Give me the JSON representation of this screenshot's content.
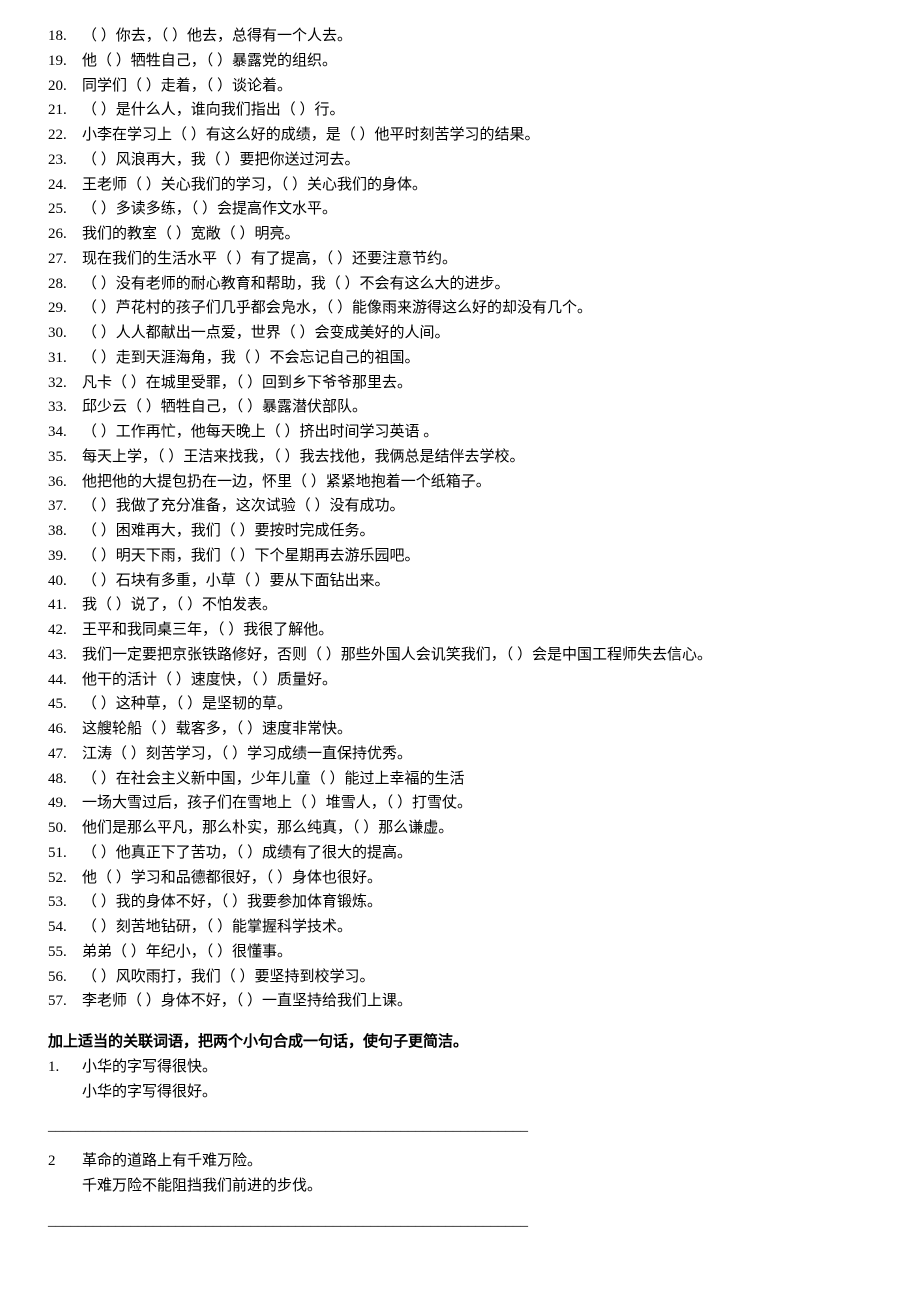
{
  "exercises": [
    {
      "n": "18.",
      "t": "（         ）你去，（         ）他去，总得有一个人去。"
    },
    {
      "n": "19.",
      "t": "他（         ）牺牲自己，（         ）暴露党的组织。"
    },
    {
      "n": "20.",
      "t": "同学们（         ）走着，（         ）谈论着。"
    },
    {
      "n": "21.",
      "t": "（         ）是什么人，谁向我们指出（         ）行。"
    },
    {
      "n": "22.",
      "t": "小李在学习上（         ）有这么好的成绩，是（         ）他平时刻苦学习的结果。"
    },
    {
      "n": "23.",
      "t": "（         ）风浪再大，我（         ）要把你送过河去。"
    },
    {
      "n": "24.",
      "t": "王老师（         ）关心我们的学习，（         ）关心我们的身体。"
    },
    {
      "n": "25.",
      "t": "（         ）多读多练，（         ）会提高作文水平。"
    },
    {
      "n": "26.",
      "t": "我们的教室（         ）宽敞（         ）明亮。"
    },
    {
      "n": "27.",
      "t": "现在我们的生活水平（         ）有了提高，（         ）还要注意节约。"
    },
    {
      "n": "28.",
      "t": "（         ）没有老师的耐心教育和帮助，我（         ）不会有这么大的进步。"
    },
    {
      "n": "29.",
      "t": "（         ）芦花村的孩子们几乎都会凫水，（         ）能像雨来游得这么好的却没有几个。"
    },
    {
      "n": "30.",
      "t": "（         ）人人都献出一点爱，世界（         ）会变成美好的人间。"
    },
    {
      "n": "31.",
      "t": "（         ）走到天涯海角，我（         ）不会忘记自己的祖国。"
    },
    {
      "n": "32.",
      "t": "凡卡（         ）在城里受罪，（         ）回到乡下爷爷那里去。"
    },
    {
      "n": "33.",
      "t": "邱少云（         ）牺牲自己，（         ）暴露潜伏部队。"
    },
    {
      "n": "34.",
      "t": "（         ）工作再忙，他每天晚上（         ）挤出时间学习英语 。"
    },
    {
      "n": "35.",
      "t": "每天上学，（         ）王洁来找我，（         ）我去找他，我俩总是结伴去学校。"
    },
    {
      "n": "36.",
      "t": "他把他的大提包扔在一边，怀里（         ）紧紧地抱着一个纸箱子。"
    },
    {
      "n": "37.",
      "t": "（         ）我做了充分准备，这次试验（         ）没有成功。"
    },
    {
      "n": "38.",
      "t": "（         ）困难再大，我们（         ）要按时完成任务。"
    },
    {
      "n": "39.",
      "t": "（         ）明天下雨，我们（         ）下个星期再去游乐园吧。"
    },
    {
      "n": "40.",
      "t": "（         ）石块有多重，小草（         ）要从下面钻出来。"
    },
    {
      "n": "41.",
      "t": "我（         ）说了，（         ）不怕发表。"
    },
    {
      "n": "42.",
      "t": "王平和我同桌三年，（         ）我很了解他。"
    },
    {
      "n": "43.",
      "t": "我们一定要把京张铁路修好，否则（       ）那些外国人会讥笑我们，（       ）会是中国工程师失去信心。"
    },
    {
      "n": "44.",
      "t": "他干的活计（         ）速度快，（         ）质量好。"
    },
    {
      "n": "45.",
      "t": "（         ）这种草，（         ）是坚韧的草。"
    },
    {
      "n": "46.",
      "t": "这艘轮船（         ）载客多，（         ）速度非常快。"
    },
    {
      "n": "47.",
      "t": "江涛（         ）刻苦学习，（         ）学习成绩一直保持优秀。"
    },
    {
      "n": "48.",
      "t": "（         ）在社会主义新中国，少年儿童（         ）能过上幸福的生活"
    },
    {
      "n": "49.",
      "t": "一场大雪过后，孩子们在雪地上（         ）堆雪人，（         ）打雪仗。"
    },
    {
      "n": "50.",
      "t": "他们是那么平凡，那么朴实，那么纯真，（         ）那么谦虚。"
    },
    {
      "n": "51.",
      "t": "（         ）他真正下了苦功，（         ）成绩有了很大的提高。"
    },
    {
      "n": "52.",
      "t": "他（        ）学习和品德都很好，（        ）身体也很好。"
    },
    {
      "n": "53.",
      "t": "（         ）我的身体不好，（        ）我要参加体育锻炼。"
    },
    {
      "n": "54.",
      "t": "（         ）刻苦地钻研，（         ）能掌握科学技术。"
    },
    {
      "n": "55.",
      "t": "弟弟（         ）年纪小，（         ）很懂事。"
    },
    {
      "n": "56.",
      "t": "（         ）风吹雨打，我们（         ）要坚持到校学习。"
    },
    {
      "n": "57.",
      "t": "李老师（        ）身体不好，（        ）一直坚持给我们上课。"
    }
  ],
  "section_title": "加上适当的关联词语，把两个小句合成一句话，使句子更简洁。",
  "combine": [
    {
      "n": "1.",
      "a": "小华的字写得很快。",
      "b": "小华的字写得很好。"
    },
    {
      "n": "2",
      "a": "革命的道路上有千难万险。",
      "b": "千难万险不能阻挡我们前进的步伐。"
    }
  ],
  "line": "________________________________________________________________"
}
